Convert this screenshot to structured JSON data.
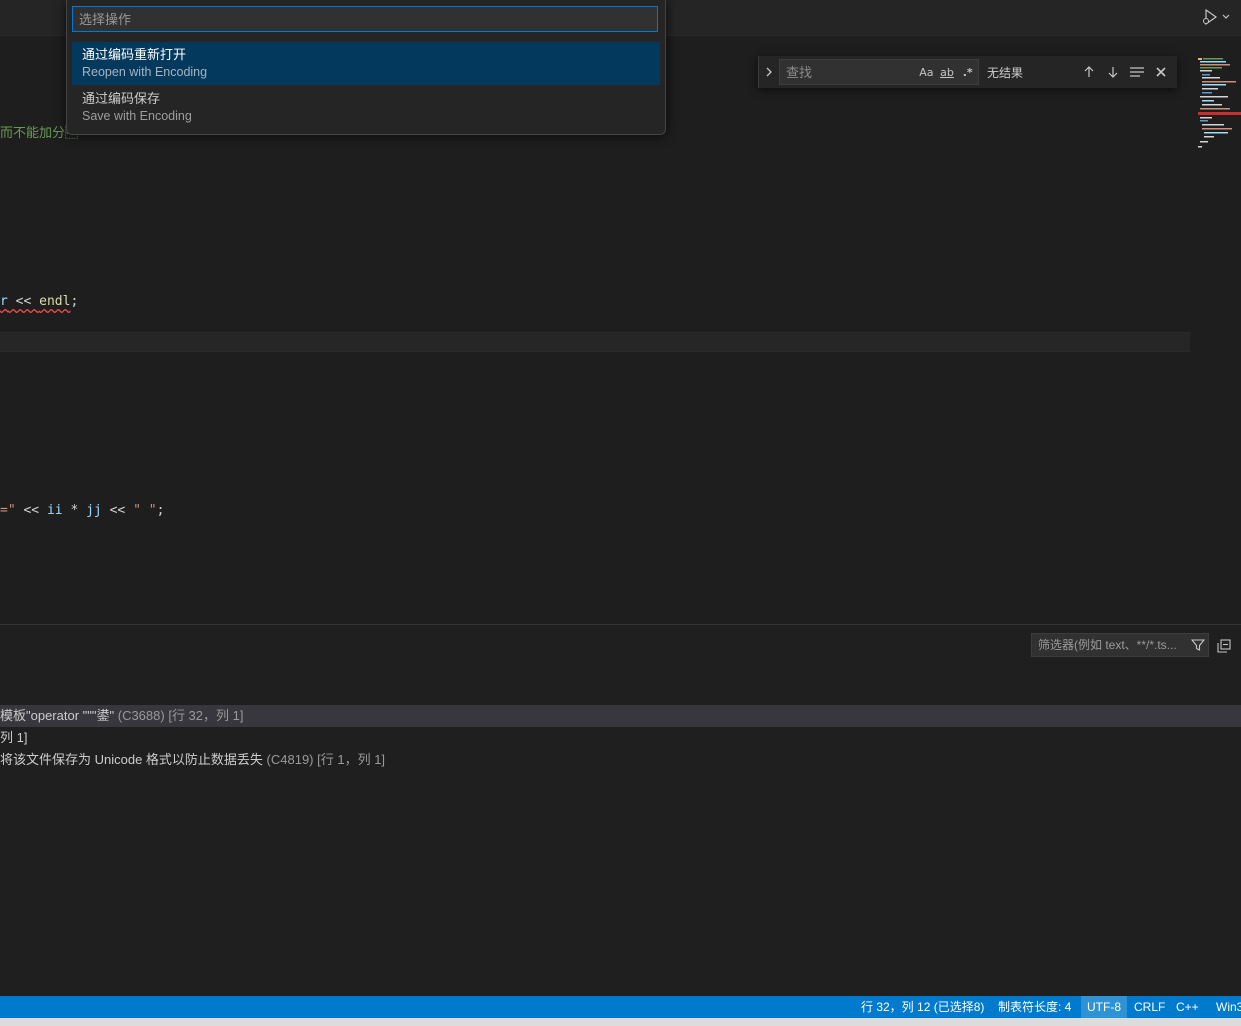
{
  "quick_pick": {
    "placeholder": "选择操作",
    "items": [
      {
        "label": "通过编码重新打开",
        "detail": "Reopen with Encoding",
        "selected": true
      },
      {
        "label": "通过编码保存",
        "detail": "Save with Encoding",
        "selected": false
      }
    ]
  },
  "find_widget": {
    "placeholder": "查找",
    "match_case": "Aa",
    "whole_word": "ab",
    "regex": ".*",
    "result": "无结果"
  },
  "editor": {
    "lines": [
      {
        "parts": [
          {
            "text": "而不能加分\u0010",
            "color": "#6a9955"
          }
        ]
      },
      {
        "parts": [
          {
            "text": "r",
            "color": "#9cdcfe",
            "squiggle": true
          },
          {
            "text": " << ",
            "color": "#d4d4d4",
            "squiggle": true
          },
          {
            "text": "endl",
            "color": "#dcdcaa",
            "squiggle": true
          },
          {
            "text": ";",
            "color": "#d4d4d4"
          }
        ]
      },
      {
        "parts": [
          {
            "text": "=\"",
            "color": "#ce9178"
          },
          {
            "text": " << ",
            "color": "#d4d4d4"
          },
          {
            "text": "ii",
            "color": "#9cdcfe"
          },
          {
            "text": " * ",
            "color": "#d4d4d4"
          },
          {
            "text": "jj",
            "color": "#9cdcfe"
          },
          {
            "text": " << ",
            "color": "#d4d4d4"
          },
          {
            "text": "\" \"",
            "color": "#ce9178"
          },
          {
            "text": ";",
            "color": "#d4d4d4"
          }
        ]
      }
    ]
  },
  "panel": {
    "filter_placeholder": "筛选器(例如 text、**/*.ts...",
    "problems": [
      {
        "message": "模板\"operator \"\"\"鍙\"",
        "code": "(C3688)",
        "location": "[行 32，列 1]",
        "selected": true
      },
      {
        "message": "列 1]",
        "code": "",
        "location": "",
        "selected": false
      },
      {
        "message": "将该文件保存为 Unicode 格式以防止数据丢失",
        "code": "(C4819)",
        "location": "[行 1，列 1]",
        "selected": false
      }
    ]
  },
  "status_bar": {
    "position": "行 32，列 12 (已选择8)",
    "indent": "制表符长度: 4",
    "encoding": "UTF-8",
    "eol": "CRLF",
    "language": "C++",
    "platform": "Win3"
  },
  "colors": {
    "accent": "#007acc",
    "quickpick_selected": "#04395e",
    "focus_border": "#0078d4"
  },
  "icons": {
    "run": "run-debug-icon",
    "find_toggle": "chevron-right-icon",
    "prev": "arrow-up-icon",
    "next": "arrow-down-icon",
    "selection": "find-in-selection-icon",
    "close": "close-icon",
    "filter": "filter-icon",
    "collapse": "collapse-all-icon"
  }
}
